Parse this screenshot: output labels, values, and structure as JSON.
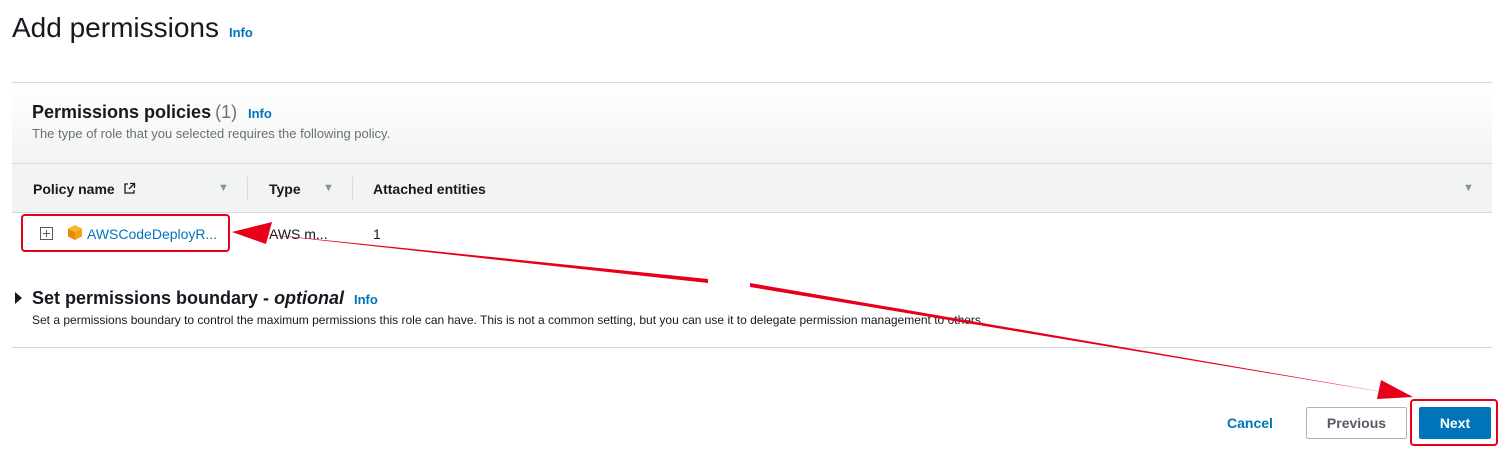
{
  "page": {
    "title": "Add permissions",
    "info_label": "Info"
  },
  "permissions_policies": {
    "title": "Permissions policies",
    "count": "(1)",
    "info_label": "Info",
    "description": "The type of role that you selected requires the following policy.",
    "columns": [
      "Policy name",
      "Type",
      "Attached entities"
    ],
    "rows": [
      {
        "policy_name": "AWSCodeDeployR...",
        "type": "AWS m...",
        "attached_entities": "1"
      }
    ]
  },
  "boundary": {
    "title": "Set permissions boundary - ",
    "title_optional": "optional",
    "info_label": "Info",
    "description": "Set a permissions boundary to control the maximum permissions this role can have. This is not a common setting, but you can use it to delegate permission management to others."
  },
  "footer": {
    "cancel_label": "Cancel",
    "previous_label": "Previous",
    "next_label": "Next"
  },
  "colors": {
    "accent": "#0073bb",
    "annotation": "#e8001a",
    "policy_icon": "#f0a410"
  },
  "icons": {
    "external_link": "external-link-icon",
    "expand": "expand-plus-icon",
    "policy": "aws-managed-cube-icon",
    "sort": "sort-caret-icon",
    "boundary_toggle": "caret-right-icon"
  }
}
